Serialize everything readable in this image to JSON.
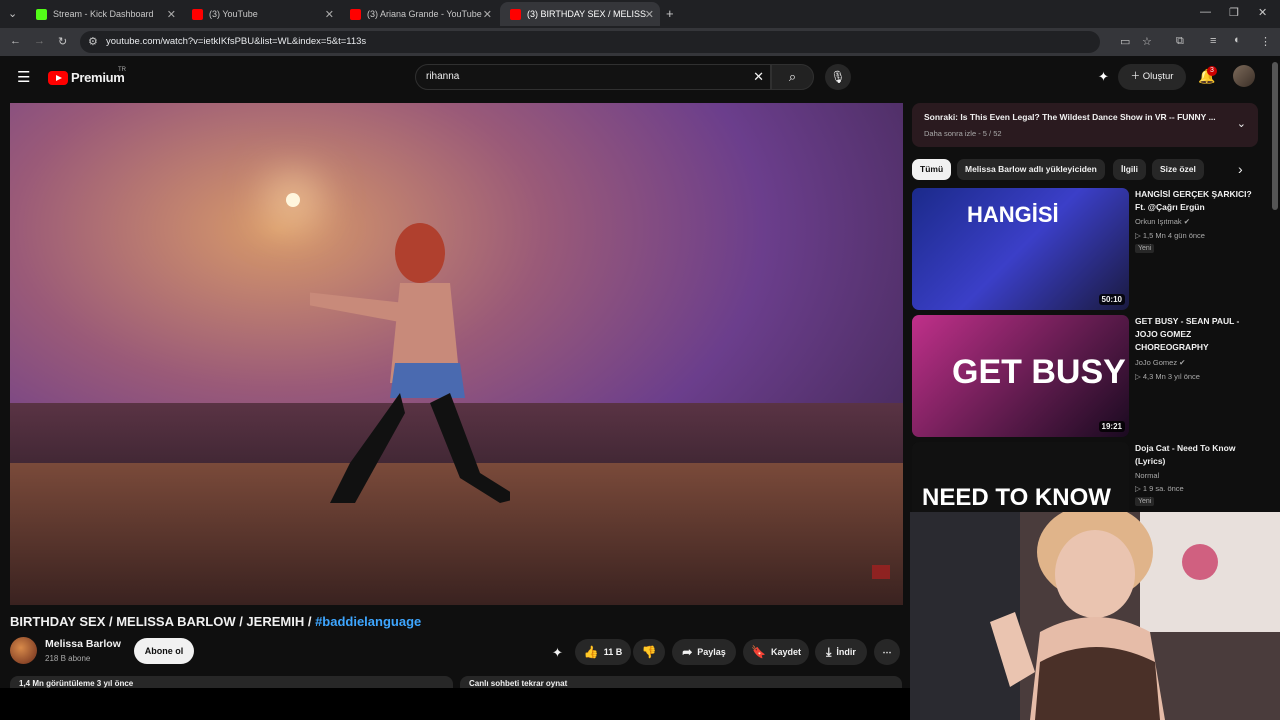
{
  "browser": {
    "tabs": [
      {
        "label": "Stream - Kick Dashboard",
        "fav": "#53fc18"
      },
      {
        "label": "(3) YouTube",
        "fav": "#ff0000"
      },
      {
        "label": "(3) Ariana Grande - YouTube",
        "fav": "#ff0000"
      },
      {
        "label": "(3) BIRTHDAY SEX / MELISS",
        "fav": "#ff0000"
      }
    ],
    "url": "youtube.com/watch?v=ietkIKfsPBU&list=WL&index=5&t=113s"
  },
  "masthead": {
    "logo_text": "Premium",
    "country": "TR",
    "search_value": "rihanna",
    "create_label": "Oluştur",
    "notif_count": "3"
  },
  "video": {
    "title_plain": "BIRTHDAY SEX / MELISSA BARLOW / JEREMIH / ",
    "title_tag": "#baddielanguage",
    "channel": "Melissa Barlow",
    "subscribers": "218 B abone",
    "subscribe_label": "Abone ol",
    "likes": "11 B",
    "share_label": "Paylaş",
    "save_label": "Kaydet",
    "download_label": "İndir",
    "views_line": "1,4 Mn görüntüleme  3 yıl önce",
    "chat_replay": "Canlı sohbeti tekrar oynat"
  },
  "playlist": {
    "next_title": "Sonraki: Is This Even Legal? The Wildest Dance Show in VR -- FUNNY ...",
    "sub": "Daha sonra izle - 5 / 52"
  },
  "chips": [
    "Tümü",
    "Melissa Barlow adlı yükleyiciden",
    "İlgili",
    "Size özel"
  ],
  "recs": [
    {
      "title": "HANGİSİ GERÇEK ŞARKICI? Ft. @Çağrı Ergün",
      "channel": "Orkun Işıtmak ✔",
      "meta": "▷ 1,5 Mn  4 gün önce",
      "badge": "Yeni",
      "duration": "50:10",
      "thumb_text": "HANGİSİ"
    },
    {
      "title": "GET BUSY - SEAN PAUL - JOJO GOMEZ CHOREOGRAPHY",
      "channel": "JoJo Gomez ✔",
      "meta": "▷ 4,3 Mn  3 yıl önce",
      "badge": "",
      "duration": "19:21",
      "thumb_text": "GET BUSY"
    },
    {
      "title": "Doja Cat - Need To Know (Lyrics)",
      "channel": "Normal",
      "meta": "▷ 1  9 sa. önce",
      "badge": "Yeni",
      "duration": "",
      "thumb_text": "NEED TO KNOW"
    }
  ]
}
